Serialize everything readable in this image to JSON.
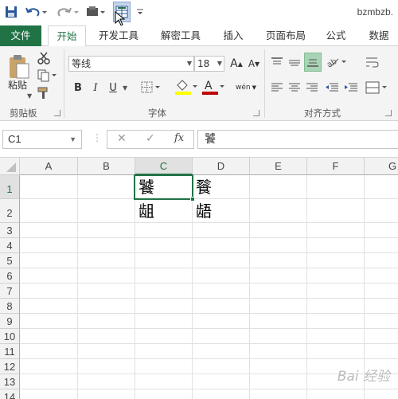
{
  "app": {
    "window_title": "bzmbzb.",
    "accent_color": "#217346"
  },
  "quick_access": {
    "icons": [
      "save-icon",
      "undo-icon",
      "redo-icon",
      "repeat-icon",
      "format-painter-qat-icon",
      "customize-icon"
    ]
  },
  "tabs": [
    {
      "label": "文件"
    },
    {
      "label": "开始"
    },
    {
      "label": "开发工具"
    },
    {
      "label": "解密工具"
    },
    {
      "label": "插入"
    },
    {
      "label": "页面布局"
    },
    {
      "label": "公式"
    },
    {
      "label": "数据"
    }
  ],
  "ribbon": {
    "clipboard": {
      "paste_label": "粘贴",
      "group_label": "剪贴板"
    },
    "font": {
      "font_name": "等线",
      "font_size": "18",
      "group_label": "字体",
      "bold": "B",
      "italic": "I",
      "underline": "U",
      "grow": "A",
      "shrink": "A",
      "phonetic": "wén"
    },
    "alignment": {
      "group_label": "对齐方式"
    }
  },
  "formula_bar": {
    "name_box": "C1",
    "cancel": "✕",
    "enter": "✓",
    "fx": "fx",
    "content": "饕"
  },
  "grid": {
    "columns": [
      "A",
      "B",
      "C",
      "D",
      "E",
      "F",
      "G"
    ],
    "rows": [
      "1",
      "2",
      "3",
      "4",
      "5",
      "6",
      "7",
      "8",
      "9",
      "10",
      "11",
      "12",
      "13",
      "14"
    ],
    "selected_cell": "C1",
    "cells": {
      "C1": "饕",
      "D1": "餮",
      "C2": "龃",
      "D2": "龉"
    }
  },
  "watermark": "Bai 经验"
}
